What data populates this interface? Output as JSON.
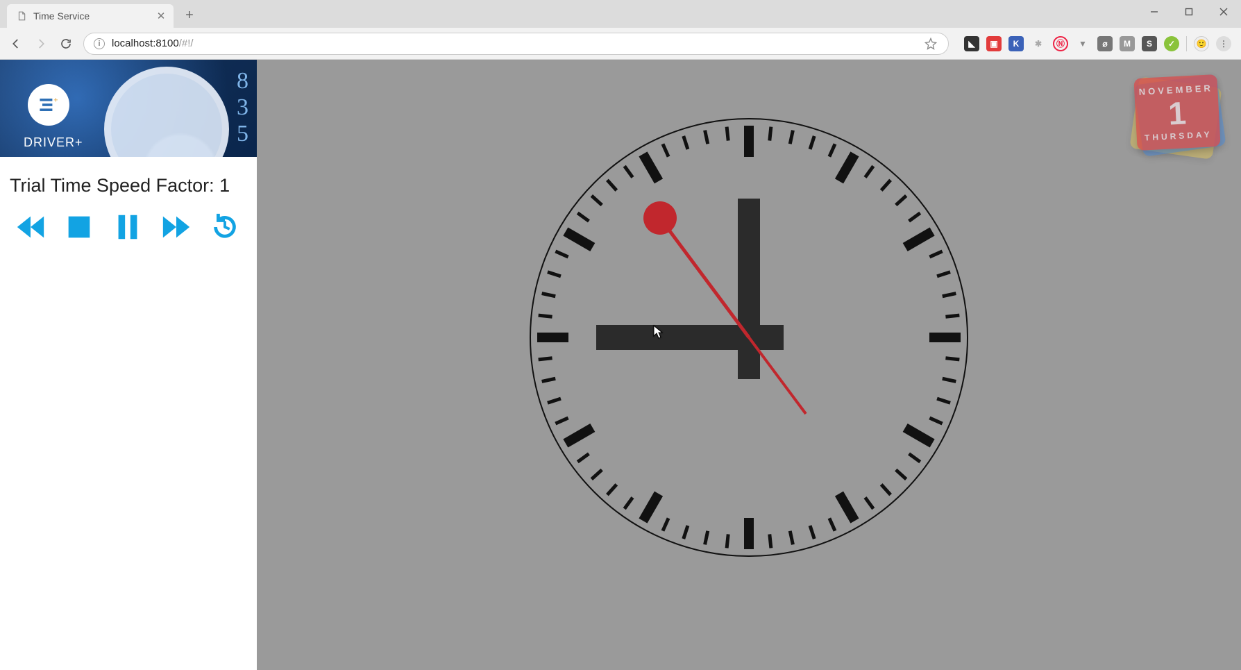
{
  "browser": {
    "tab_title": "Time Service",
    "url_host": "localhost:8100",
    "url_path": "/#!/"
  },
  "sidebar": {
    "brand": "DRIVER+",
    "speed_label_prefix": "Trial Time Speed Factor: ",
    "speed_value": "1",
    "controls": {
      "rewind": "rewind",
      "stop": "stop",
      "pause": "pause",
      "forward": "fast-forward",
      "reset": "reset-time"
    }
  },
  "clock": {
    "hour": 12,
    "minute": 45,
    "second": 52
  },
  "calendar": {
    "month": "NOVEMBER",
    "day": "1",
    "weekday": "THURSDAY"
  }
}
